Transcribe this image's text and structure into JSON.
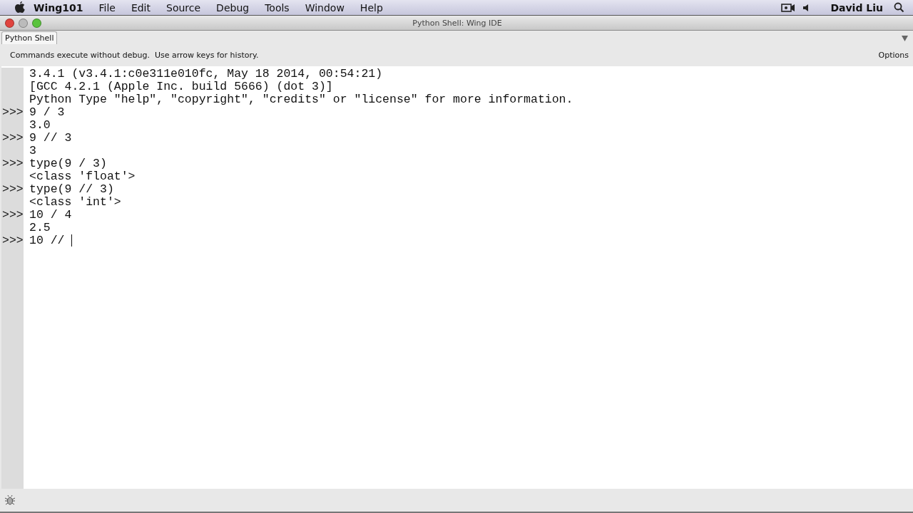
{
  "menu_bar": {
    "app": "Wing101",
    "items": [
      "File",
      "Edit",
      "Source",
      "Debug",
      "Tools",
      "Window",
      "Help"
    ],
    "user": "David Liu"
  },
  "window": {
    "title": "Python Shell: Wing IDE"
  },
  "tabs": [
    {
      "label": "Python Shell",
      "selected": true
    }
  ],
  "hint": "Commands execute without debug.  Use arrow keys for history.",
  "options": "Options",
  "shell_lines": [
    {
      "text": "3.4.1 (v3.4.1:c0e311e010fc, May 18 2014, 00:54:21)"
    },
    {
      "text": "[GCC 4.2.1 (Apple Inc. build 5666) (dot 3)]"
    },
    {
      "text": "Python Type \"help\", \"copyright\", \"credits\" or \"license\" for more information."
    },
    {
      "prompt": ">>>",
      "text": "9 / 3"
    },
    {
      "text": "3.0"
    },
    {
      "prompt": ">>>",
      "text": "9 // 3"
    },
    {
      "text": "3"
    },
    {
      "prompt": ">>>",
      "text": "type(9 / 3)"
    },
    {
      "text": "<class 'float'>"
    },
    {
      "prompt": ">>>",
      "text": "type(9 // 3)"
    },
    {
      "text": "<class 'int'>"
    },
    {
      "prompt": ">>>",
      "text": "10 / 4"
    },
    {
      "text": "2.5"
    },
    {
      "prompt": ">>>",
      "text": "10 // ",
      "cursor": true
    }
  ]
}
